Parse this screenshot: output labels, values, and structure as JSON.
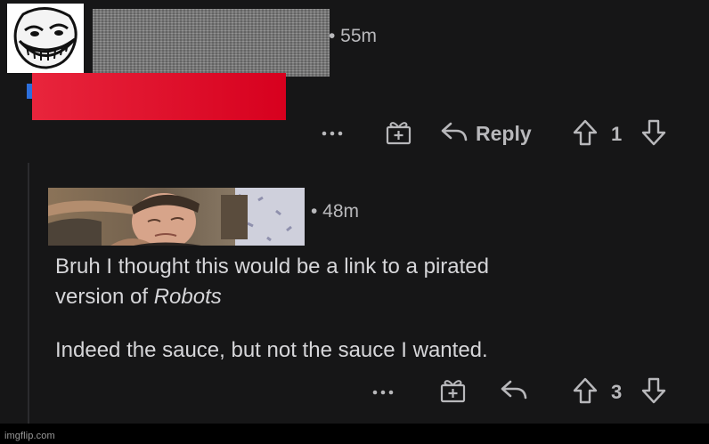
{
  "comment1": {
    "timestamp": "• 55m",
    "actions": {
      "reply_label": "Reply",
      "vote_count": "1"
    }
  },
  "comment2": {
    "timestamp": "• 48m",
    "body_line1": "Bruh I thought this would be a link to a pirated",
    "body_line2_prefix": "version of ",
    "body_line2_italic": "Robots",
    "body_line3": "Indeed the sauce, but not the sauce I wanted.",
    "actions": {
      "vote_count": "3"
    }
  },
  "footer": {
    "watermark": "imgflip.com"
  },
  "colors": {
    "background": "#161617",
    "text_muted": "#b8b8bb",
    "text_body": "#d6d6d9",
    "redaction_red": "#e0102c"
  },
  "icons": [
    "troll-face-icon",
    "more-icon",
    "award-icon",
    "reply-icon",
    "upvote-icon",
    "downvote-icon"
  ]
}
